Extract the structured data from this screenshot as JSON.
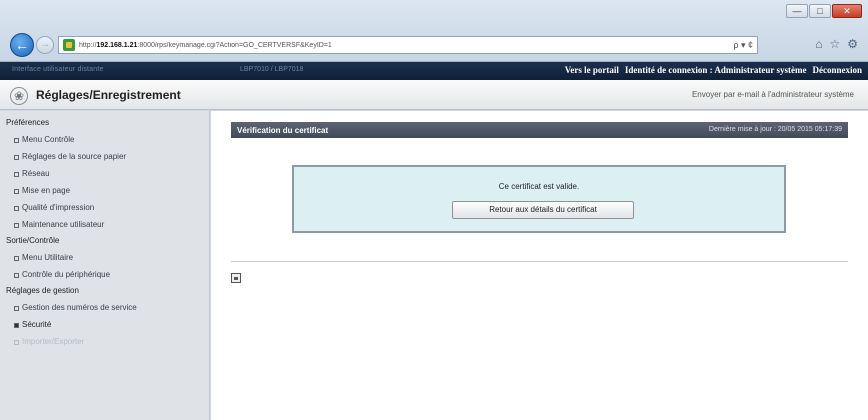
{
  "browser": {
    "url_host": "192.168.1.21",
    "url_rest": "http:// :8000/rps/keymanage.cgi?Action=GO_CERTVERSF&KeyID=1",
    "url_prefix": "http://",
    "url_suffix": ":8000/rps/keymanage.cgi?Action=GO_CERTVERSF&KeyID=1",
    "addr_tools": "ρ ▾ ¢",
    "window_buttons": [
      "—",
      "□",
      "✕"
    ],
    "tool_icons": [
      "home-icon",
      "star-icon",
      "gear-icon"
    ]
  },
  "topbar": {
    "left_dim_text": "Interface utilisateur distante",
    "mid_dim_text": "LBP7010 / LBP7018",
    "portal_link": "Vers le portail",
    "login_label": "Identité de connexion : Administrateur système",
    "logout_link": "Déconnexion"
  },
  "header": {
    "title": "Réglages/Enregistrement",
    "mail_link": "Envoyer par e-mail à l'administrateur système"
  },
  "sidebar": {
    "groups": [
      {
        "label": "Préférences",
        "items": [
          "Menu Contrôle",
          "Réglages de la source papier",
          "Réseau",
          "Mise en page",
          "Qualité d'impression",
          "Maintenance utilisateur"
        ]
      },
      {
        "label": "Sortie/Contrôle",
        "items": [
          "Menu Utilitaire",
          "Contrôle du périphérique"
        ]
      },
      {
        "label": "Réglages de gestion",
        "items": [
          "Gestion des numéros de service",
          "Sécurité",
          "Importer/Exporter"
        ]
      }
    ],
    "active_item": "Sécurité"
  },
  "main": {
    "panel_title": "Vérification du certificat",
    "last_update": "Dernière mise à jour : 20/05 2015 05:17:39",
    "result_message": "Ce certificat est valide.",
    "back_button": "Retour aux détails du certificat"
  }
}
